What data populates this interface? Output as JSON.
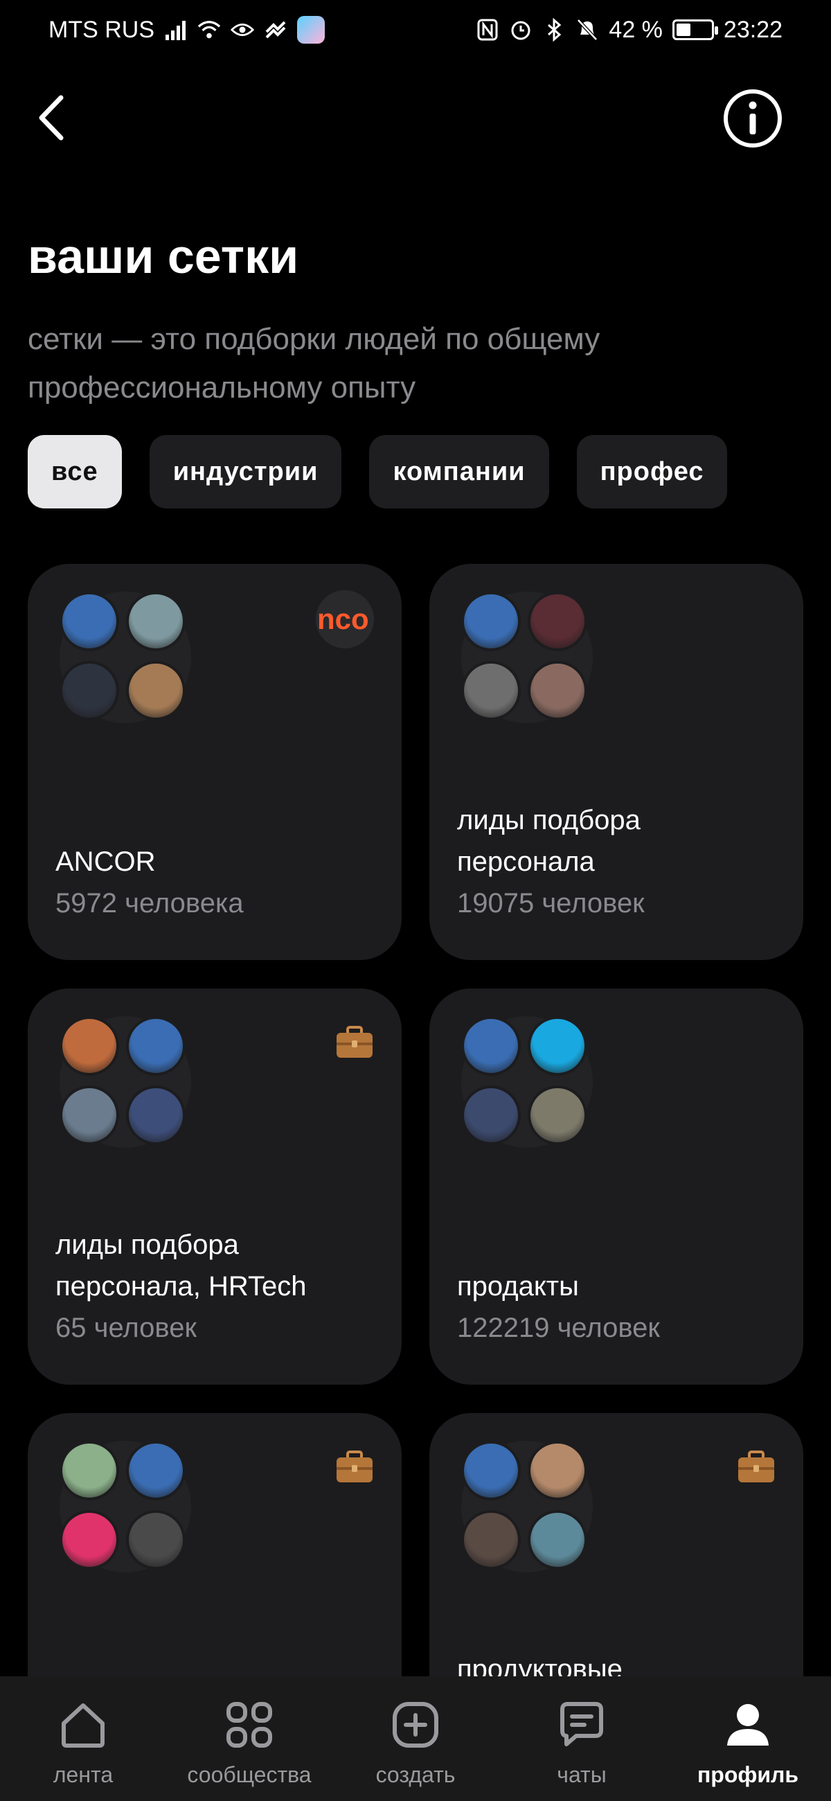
{
  "status": {
    "carrier": "MTS RUS",
    "battery_percent": "42 %",
    "battery_level": 0.42,
    "time": "23:22"
  },
  "header": {
    "title": "ваши сетки",
    "subtitle": "сетки — это подборки людей по общему профессиональному опыту"
  },
  "filters": [
    {
      "label": "все",
      "active": true
    },
    {
      "label": "индустрии",
      "active": false
    },
    {
      "label": "компании",
      "active": false
    },
    {
      "label": "профес",
      "active": false
    }
  ],
  "cards": [
    {
      "name": "ANCOR",
      "count": "5972 человека",
      "badge": "nco",
      "badge_type": "logo",
      "avatars": [
        "#3a6db3",
        "#7e9aa0",
        "#2e3340",
        "#a57b55"
      ]
    },
    {
      "name": "лиды подбора персонала",
      "count": "19075 человек",
      "badge_type": "none",
      "avatars": [
        "#3a6db3",
        "#5a2c34",
        "#6e6e6e",
        "#8a6a60"
      ]
    },
    {
      "name": "лиды подбора персонала, HRTech",
      "count": "65 человек",
      "badge_type": "briefcase",
      "avatars": [
        "#c06b3e",
        "#3a6db3",
        "#6a7c8e",
        "#3d4e7a"
      ]
    },
    {
      "name": "продакты",
      "count": "122219 человек",
      "badge_type": "none",
      "avatars": [
        "#3a6db3",
        "#1aa8e0",
        "#3c4a6e",
        "#7d7a6a"
      ]
    },
    {
      "name": "",
      "count": "",
      "badge_type": "briefcase",
      "avatars": [
        "#8bb08a",
        "#3a6db3",
        "#e0336b",
        "#4a4a4a"
      ]
    },
    {
      "name": "продуктовые",
      "count": "",
      "badge_type": "briefcase",
      "avatars": [
        "#3a6db3",
        "#b58a6a",
        "#5a4a44",
        "#5d8a9a"
      ]
    }
  ],
  "nav": [
    {
      "label": "лента",
      "icon": "home-icon",
      "active": false
    },
    {
      "label": "сообщества",
      "icon": "grid-icon",
      "active": false
    },
    {
      "label": "создать",
      "icon": "plus-square-icon",
      "active": false
    },
    {
      "label": "чаты",
      "icon": "chat-icon",
      "active": false
    },
    {
      "label": "профиль",
      "icon": "person-icon",
      "active": true
    }
  ]
}
